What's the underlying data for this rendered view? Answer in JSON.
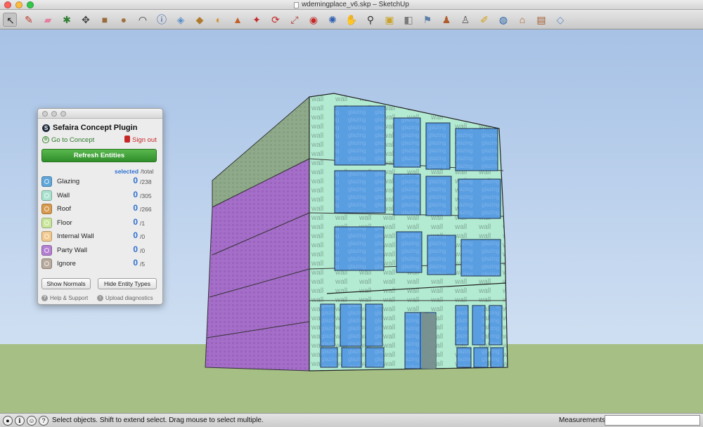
{
  "window": {
    "title": "wdemingplace_v6.skp – SketchUp"
  },
  "toolbar": {
    "tools": [
      {
        "icon": "select-arrow-icon",
        "glyph": "↖",
        "color": "#222222"
      },
      {
        "icon": "pencil-icon",
        "glyph": "✎",
        "color": "#c0392b"
      },
      {
        "icon": "eraser-icon",
        "glyph": "▰",
        "color": "#e57fa0"
      },
      {
        "icon": "axes-icon",
        "glyph": "✱",
        "color": "#2f7d32"
      },
      {
        "icon": "move-icon",
        "glyph": "✥",
        "color": "#444444"
      },
      {
        "icon": "rectangle-icon",
        "glyph": "■",
        "color": "#9a6a3a"
      },
      {
        "icon": "circle-icon",
        "glyph": "●",
        "color": "#a0713e"
      },
      {
        "icon": "arc-icon",
        "glyph": "◠",
        "color": "#333333"
      },
      {
        "icon": "info-icon",
        "glyph": "ⓘ",
        "color": "#1f4fa8"
      },
      {
        "icon": "component-icon",
        "glyph": "◈",
        "color": "#5b8fc9"
      },
      {
        "icon": "paint-bucket-icon",
        "glyph": "◆",
        "color": "#b07a2a"
      },
      {
        "icon": "follow-me-icon",
        "glyph": "◐",
        "color": "#d2942c"
      },
      {
        "icon": "push-pull-icon",
        "glyph": "▲",
        "color": "#c0602b"
      },
      {
        "icon": "offset-icon",
        "glyph": "✦",
        "color": "#c62828"
      },
      {
        "icon": "rotate-icon",
        "glyph": "⟳",
        "color": "#c62828"
      },
      {
        "icon": "scale-icon",
        "glyph": "⤢",
        "color": "#b0413e"
      },
      {
        "icon": "tape-measure-icon",
        "glyph": "◉",
        "color": "#c62828"
      },
      {
        "icon": "orbit-icon",
        "glyph": "✺",
        "color": "#2d5fb0"
      },
      {
        "icon": "pan-hand-icon",
        "glyph": "✋",
        "color": "#555555"
      },
      {
        "icon": "zoom-icon",
        "glyph": "⚲",
        "color": "#333333"
      },
      {
        "icon": "zoom-window-icon",
        "glyph": "▣",
        "color": "#c9a227"
      },
      {
        "icon": "previous-view-icon",
        "glyph": "◧",
        "color": "#7a7a7a"
      },
      {
        "icon": "walk-icon",
        "glyph": "⚑",
        "color": "#5b7fa8"
      },
      {
        "icon": "position-camera-icon",
        "glyph": "♟",
        "color": "#b05b2b"
      },
      {
        "icon": "look-around-icon",
        "glyph": "♙",
        "color": "#555555"
      },
      {
        "icon": "section-plane-icon",
        "glyph": "✐",
        "color": "#d4a017"
      },
      {
        "icon": "geo-location-icon",
        "glyph": "◍",
        "color": "#1f5fa8"
      },
      {
        "icon": "warehouse-icon",
        "glyph": "⌂",
        "color": "#b0642b"
      },
      {
        "icon": "extension-icon",
        "glyph": "▤",
        "color": "#a05a2a"
      },
      {
        "icon": "sefaira-icon",
        "glyph": "◇",
        "color": "#5b8fc9"
      }
    ]
  },
  "plugin": {
    "title": "Sefaira Concept Plugin",
    "go_to_concept": "Go to Concept",
    "sign_out": "Sign out",
    "refresh_label": "Refresh Entities",
    "header_selected": "selected",
    "header_total": "/total",
    "entities": [
      {
        "label": "Glazing",
        "selected": "0",
        "total": "/238",
        "color": "#5fa6da"
      },
      {
        "label": "Wall",
        "selected": "0",
        "total": "/305",
        "color": "#a9e2cf"
      },
      {
        "label": "Roof",
        "selected": "0",
        "total": "/266",
        "color": "#d79a4e"
      },
      {
        "label": "Floor",
        "selected": "0",
        "total": "/1",
        "color": "#c9e59a"
      },
      {
        "label": "Internal Wall",
        "selected": "0",
        "total": "/0",
        "color": "#f2c98e"
      },
      {
        "label": "Party Wall",
        "selected": "0",
        "total": "/0",
        "color": "#b47fd2"
      },
      {
        "label": "Ignore",
        "selected": "0",
        "total": "/5",
        "color": "#b8aa9c"
      }
    ],
    "show_normals": "Show Normals",
    "hide_entity_types": "Hide Entity Types",
    "help_support": "Help & Support",
    "upload_diagnostics": "Upload diagnostics"
  },
  "scene": {
    "wall_label": "wall",
    "glazing_label": "glazing",
    "colors": {
      "wall": "#b3ebd2",
      "glazing": "#5a9ee2",
      "party_wall": "#a56ec8",
      "roof_side": "#8faa8a"
    }
  },
  "statusbar": {
    "message": "Select objects. Shift to extend select. Drag mouse to select multiple.",
    "measurements_label": "Measurements",
    "measurements_value": ""
  }
}
